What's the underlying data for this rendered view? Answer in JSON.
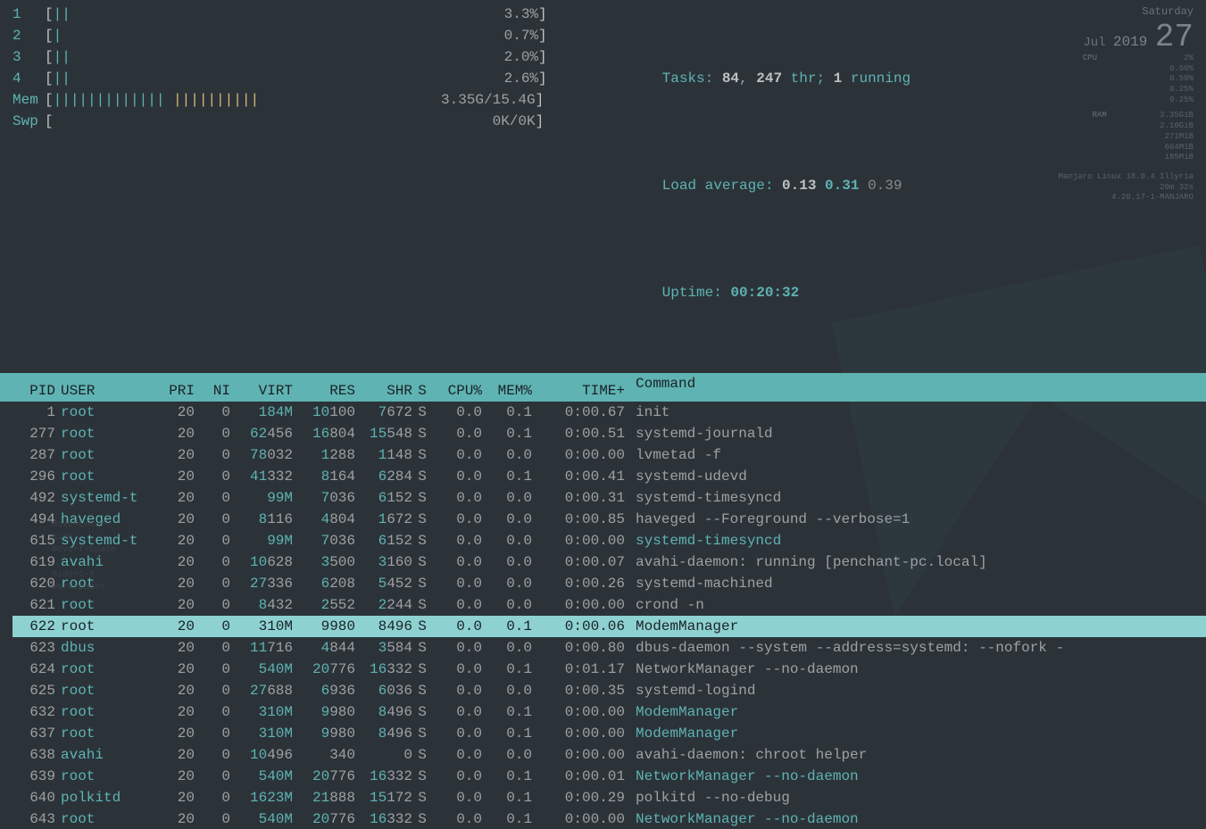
{
  "cpu_meters": [
    {
      "label": "1",
      "bars": "||",
      "pct": "3.3%"
    },
    {
      "label": "2",
      "bars": "|",
      "pct": "0.7%"
    },
    {
      "label": "3",
      "bars": "||",
      "pct": "2.0%"
    },
    {
      "label": "4",
      "bars": "||",
      "pct": "2.6%"
    }
  ],
  "mem": {
    "label": "Mem",
    "bars_green": "||||||||||||| ",
    "bars_yellow": "||||||||||",
    "value": "3.35G/15.4G"
  },
  "swap": {
    "label": "Swp",
    "value": "0K/0K"
  },
  "tasks": {
    "label": "Tasks: ",
    "total": "84",
    "sep": ", ",
    "threads": "247",
    "thr": " thr; ",
    "running": "1",
    "run_lbl": " running"
  },
  "load": {
    "label": "Load average: ",
    "a": "0.13",
    "b": "0.31",
    "c": "0.39"
  },
  "uptime": {
    "label": "Uptime: ",
    "value": "00:20:32"
  },
  "clock": {
    "weekday": "Saturday",
    "month": "Jul",
    "day": "27",
    "year": "2019"
  },
  "sysinfo": {
    "cpu_h": "CPU",
    "cpu_v": "2%",
    "cores": [
      "0.50%",
      "0.50%",
      "0.25%",
      "0.25%"
    ],
    "ram_h": "RAM",
    "ram_v": "3.35GiB",
    "ram_lines": [
      "2.10GiB",
      "271MiB",
      "664MiB",
      "185MiB"
    ],
    "distro": "Manjaro Linux 18.0.4 Illyria",
    "up": "20m 32s",
    "kernel": "4.20.17-1-MANJARO"
  },
  "columns": {
    "pid": "PID",
    "user": "USER",
    "pri": "PRI",
    "ni": "NI",
    "virt": "VIRT",
    "res": "RES",
    "shr": "SHR",
    "s": "S",
    "cpu": "CPU%",
    "mem": "MEM%",
    "time": "TIME+",
    "cmd": "Command"
  },
  "processes": [
    {
      "pid": "1",
      "user": "root",
      "pri": "20",
      "ni": "0",
      "virt": "184M",
      "virt_hl": "184M",
      "res": "10100",
      "res_hl": "10",
      "shr": "7672",
      "shr_hl": "7",
      "s": "S",
      "cpu": "0.0",
      "mem": "0.1",
      "time": "0:00.67",
      "cmd": "init"
    },
    {
      "pid": "277",
      "user": "root",
      "pri": "20",
      "ni": "0",
      "virt": "62456",
      "virt_hl": "62",
      "res": "16804",
      "res_hl": "16",
      "shr": "15548",
      "shr_hl": "15",
      "s": "S",
      "cpu": "0.0",
      "mem": "0.1",
      "time": "0:00.51",
      "cmd": "systemd-journald"
    },
    {
      "pid": "287",
      "user": "root",
      "pri": "20",
      "ni": "0",
      "virt": "78032",
      "virt_hl": "78",
      "res": "1288",
      "res_hl": "1",
      "shr": "1148",
      "shr_hl": "1",
      "s": "S",
      "cpu": "0.0",
      "mem": "0.0",
      "time": "0:00.00",
      "cmd": "lvmetad -f"
    },
    {
      "pid": "296",
      "user": "root",
      "pri": "20",
      "ni": "0",
      "virt": "41332",
      "virt_hl": "41",
      "res": "8164",
      "res_hl": "8",
      "shr": "6284",
      "shr_hl": "6",
      "s": "S",
      "cpu": "0.0",
      "mem": "0.1",
      "time": "0:00.41",
      "cmd": "systemd-udevd"
    },
    {
      "pid": "492",
      "user": "systemd-t",
      "pri": "20",
      "ni": "0",
      "virt": "99M",
      "virt_hl": "99M",
      "res": "7036",
      "res_hl": "7",
      "shr": "6152",
      "shr_hl": "6",
      "s": "S",
      "cpu": "0.0",
      "mem": "0.0",
      "time": "0:00.31",
      "cmd": "systemd-timesyncd"
    },
    {
      "pid": "494",
      "user": "haveged",
      "pri": "20",
      "ni": "0",
      "virt": "8116",
      "virt_hl": "8",
      "res": "4804",
      "res_hl": "4",
      "shr": "1672",
      "shr_hl": "1",
      "s": "S",
      "cpu": "0.0",
      "mem": "0.0",
      "time": "0:00.85",
      "cmd": "haveged --Foreground --verbose=1"
    },
    {
      "pid": "615",
      "user": "systemd-t",
      "pri": "20",
      "ni": "0",
      "virt": "99M",
      "virt_hl": "99M",
      "res": "7036",
      "res_hl": "7",
      "shr": "6152",
      "shr_hl": "6",
      "s": "S",
      "cpu": "0.0",
      "mem": "0.0",
      "time": "0:00.00",
      "cmd": "systemd-timesyncd",
      "teal": true
    },
    {
      "pid": "619",
      "user": "avahi",
      "pri": "20",
      "ni": "0",
      "virt": "10628",
      "virt_hl": "10",
      "res": "3500",
      "res_hl": "3",
      "shr": "3160",
      "shr_hl": "3",
      "s": "S",
      "cpu": "0.0",
      "mem": "0.0",
      "time": "0:00.07",
      "cmd": "avahi-daemon: running [penchant-pc.local]"
    },
    {
      "pid": "620",
      "user": "root",
      "pri": "20",
      "ni": "0",
      "virt": "27336",
      "virt_hl": "27",
      "res": "6208",
      "res_hl": "6",
      "shr": "5452",
      "shr_hl": "5",
      "s": "S",
      "cpu": "0.0",
      "mem": "0.0",
      "time": "0:00.26",
      "cmd": "systemd-machined"
    },
    {
      "pid": "621",
      "user": "root",
      "pri": "20",
      "ni": "0",
      "virt": "8432",
      "virt_hl": "8",
      "res": "2552",
      "res_hl": "2",
      "shr": "2244",
      "shr_hl": "2",
      "s": "S",
      "cpu": "0.0",
      "mem": "0.0",
      "time": "0:00.00",
      "cmd": "crond -n"
    },
    {
      "pid": "622",
      "user": "root",
      "pri": "20",
      "ni": "0",
      "virt": "310M",
      "virt_hl": "310M",
      "res": "9980",
      "res_hl": "9",
      "shr": "8496",
      "shr_hl": "8",
      "s": "S",
      "cpu": "0.0",
      "mem": "0.1",
      "time": "0:00.06",
      "cmd": "ModemManager",
      "selected": true
    },
    {
      "pid": "623",
      "user": "dbus",
      "pri": "20",
      "ni": "0",
      "virt": "11716",
      "virt_hl": "11",
      "res": "4844",
      "res_hl": "4",
      "shr": "3584",
      "shr_hl": "3",
      "s": "S",
      "cpu": "0.0",
      "mem": "0.0",
      "time": "0:00.80",
      "cmd": "dbus-daemon --system --address=systemd: --nofork -"
    },
    {
      "pid": "624",
      "user": "root",
      "pri": "20",
      "ni": "0",
      "virt": "540M",
      "virt_hl": "540M",
      "res": "20776",
      "res_hl": "20",
      "shr": "16332",
      "shr_hl": "16",
      "s": "S",
      "cpu": "0.0",
      "mem": "0.1",
      "time": "0:01.17",
      "cmd": "NetworkManager --no-daemon"
    },
    {
      "pid": "625",
      "user": "root",
      "pri": "20",
      "ni": "0",
      "virt": "27688",
      "virt_hl": "27",
      "res": "6936",
      "res_hl": "6",
      "shr": "6036",
      "shr_hl": "6",
      "s": "S",
      "cpu": "0.0",
      "mem": "0.0",
      "time": "0:00.35",
      "cmd": "systemd-logind"
    },
    {
      "pid": "632",
      "user": "root",
      "pri": "20",
      "ni": "0",
      "virt": "310M",
      "virt_hl": "310M",
      "res": "9980",
      "res_hl": "9",
      "shr": "8496",
      "shr_hl": "8",
      "s": "S",
      "cpu": "0.0",
      "mem": "0.1",
      "time": "0:00.00",
      "cmd": "ModemManager",
      "teal": true
    },
    {
      "pid": "637",
      "user": "root",
      "pri": "20",
      "ni": "0",
      "virt": "310M",
      "virt_hl": "310M",
      "res": "9980",
      "res_hl": "9",
      "shr": "8496",
      "shr_hl": "8",
      "s": "S",
      "cpu": "0.0",
      "mem": "0.1",
      "time": "0:00.00",
      "cmd": "ModemManager",
      "teal": true
    },
    {
      "pid": "638",
      "user": "avahi",
      "pri": "20",
      "ni": "0",
      "virt": "10496",
      "virt_hl": "10",
      "res": "340",
      "res_hl": "",
      "shr": "0",
      "shr_hl": "",
      "s": "S",
      "cpu": "0.0",
      "mem": "0.0",
      "time": "0:00.00",
      "cmd": "avahi-daemon: chroot helper"
    },
    {
      "pid": "639",
      "user": "root",
      "pri": "20",
      "ni": "0",
      "virt": "540M",
      "virt_hl": "540M",
      "res": "20776",
      "res_hl": "20",
      "shr": "16332",
      "shr_hl": "16",
      "s": "S",
      "cpu": "0.0",
      "mem": "0.1",
      "time": "0:00.01",
      "cmd": "NetworkManager --no-daemon",
      "teal": true
    },
    {
      "pid": "640",
      "user": "polkitd",
      "pri": "20",
      "ni": "0",
      "virt": "1623M",
      "virt_hl": "1623M",
      "res": "21888",
      "res_hl": "21",
      "shr": "15172",
      "shr_hl": "15",
      "s": "S",
      "cpu": "0.0",
      "mem": "0.1",
      "time": "0:00.29",
      "cmd": "polkitd --no-debug"
    },
    {
      "pid": "643",
      "user": "root",
      "pri": "20",
      "ni": "0",
      "virt": "540M",
      "virt_hl": "540M",
      "res": "20776",
      "res_hl": "20",
      "shr": "16332",
      "shr_hl": "16",
      "s": "S",
      "cpu": "0.0",
      "mem": "0.1",
      "time": "0:00.00",
      "cmd": "NetworkManager --no-daemon",
      "teal": true
    }
  ],
  "help": "Move+Enter\nHide\nMove+f+Space\n\nHide+1-8\nWorkspaces"
}
